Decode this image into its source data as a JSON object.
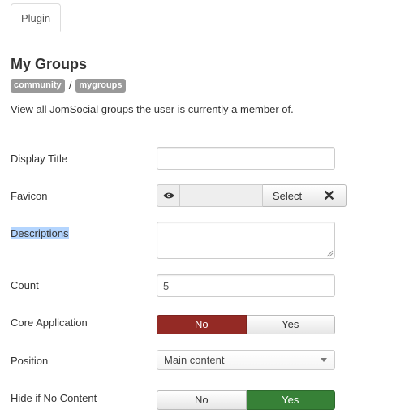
{
  "tabs": [
    {
      "label": "Plugin"
    }
  ],
  "header": {
    "title": "My Groups",
    "badges": [
      "community",
      "mygroups"
    ],
    "separator": "/",
    "description": "View all JomSocial groups the user is currently a member of."
  },
  "fields": {
    "display_title": {
      "label": "Display Title",
      "value": ""
    },
    "favicon": {
      "label": "Favicon",
      "select_label": "Select",
      "clear_label": "✕",
      "preview_icon": "eye-icon"
    },
    "descriptions": {
      "label": "Descriptions",
      "value": ""
    },
    "count": {
      "label": "Count",
      "value": "5"
    },
    "core_application": {
      "label": "Core Application",
      "options": [
        "No",
        "Yes"
      ],
      "selected": "No"
    },
    "position": {
      "label": "Position",
      "selected": "Main content"
    },
    "hide_if_no_content": {
      "label": "Hide if No Content",
      "options": [
        "No",
        "Yes"
      ],
      "selected": "Yes"
    }
  },
  "colors": {
    "toggle_no_active": "#942a25",
    "toggle_yes_active": "#378137",
    "badge": "#999999"
  }
}
